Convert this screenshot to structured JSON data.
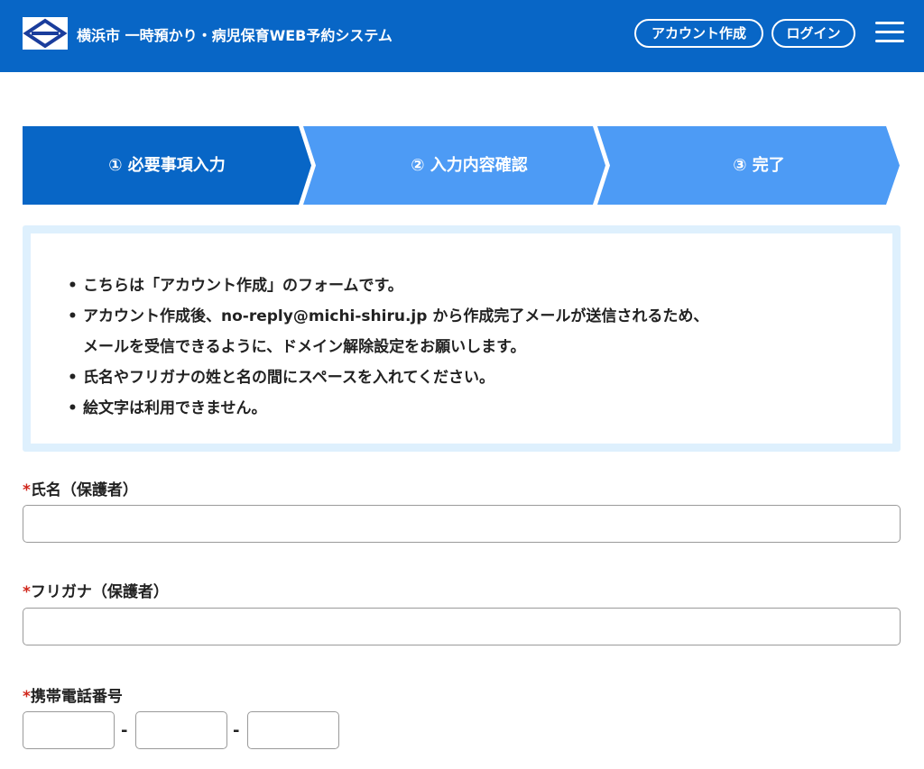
{
  "header": {
    "site_title": "横浜市 一時預かり・病児保育WEB予約システム",
    "create_account_label": "アカウント作成",
    "login_label": "ログイン",
    "brand_color": "#0866c6"
  },
  "steps": [
    {
      "label": "① 必要事項入力",
      "state": "current",
      "color": "#0866c6"
    },
    {
      "label": "② 入力内容確認",
      "state": "upcoming",
      "color": "#4d9bf5"
    },
    {
      "label": "③ 完了",
      "state": "upcoming",
      "color": "#4d9bf5"
    }
  ],
  "notice": {
    "bullet": "•",
    "items": [
      {
        "text": "こちらは「アカウント作成」のフォームです。"
      },
      {
        "text": "アカウント作成後、no-reply@michi-shiru.jp から作成完了メールが送信されるため、",
        "cont": "メールを受信できるように、ドメイン解除設定をお願いします。"
      },
      {
        "text": "氏名やフリガナの姓と名の間にスペースを入れてください。"
      },
      {
        "text": "絵文字は利用できません。"
      }
    ]
  },
  "form": {
    "required_mark": "*",
    "name": {
      "label": "氏名（保護者）",
      "value": "",
      "placeholder": ""
    },
    "furigana": {
      "label": "フリガナ（保護者）",
      "value": "",
      "placeholder": ""
    },
    "phone": {
      "label": "携帯電話番号",
      "separator": "-",
      "parts": [
        "",
        "",
        ""
      ]
    }
  }
}
